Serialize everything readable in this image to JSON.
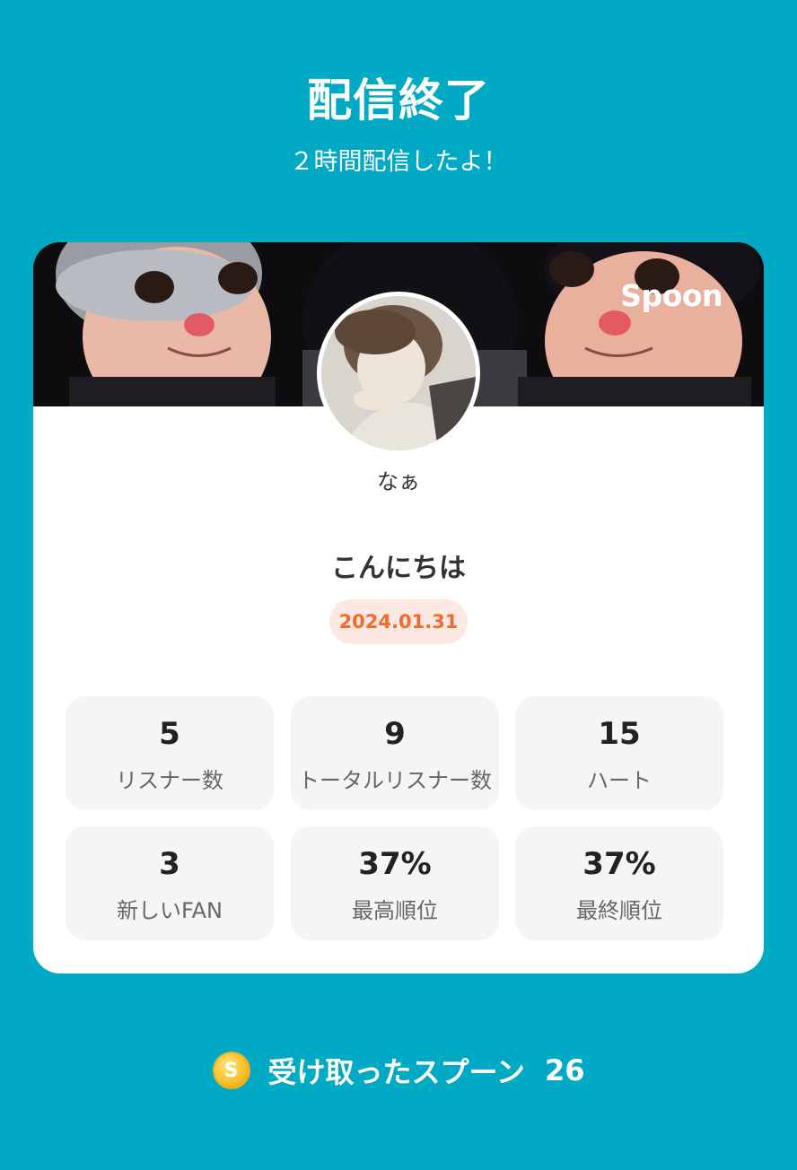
{
  "header": {
    "title": "配信終了",
    "subtitle": "２時間配信したよ！"
  },
  "card": {
    "brand": "Spoon",
    "nickname": "なぁ",
    "greeting": "こんにちは",
    "date": "2024.01.31"
  },
  "stats": [
    {
      "value": "5",
      "label": "リスナー数"
    },
    {
      "value": "9",
      "label": "トータルリスナー数"
    },
    {
      "value": "15",
      "label": "ハート"
    },
    {
      "value": "3",
      "label": "新しいFAN"
    },
    {
      "value": "37%",
      "label": "最高順位"
    },
    {
      "value": "37%",
      "label": "最終順位"
    }
  ],
  "spoons": {
    "coin_symbol": "S",
    "label": "受け取ったスプーン",
    "count": "26"
  },
  "colors": {
    "background": "#00a9c4",
    "date_badge_bg": "#fde9e2",
    "date_badge_text": "#f26b2e",
    "coin": "#f9c22a"
  }
}
